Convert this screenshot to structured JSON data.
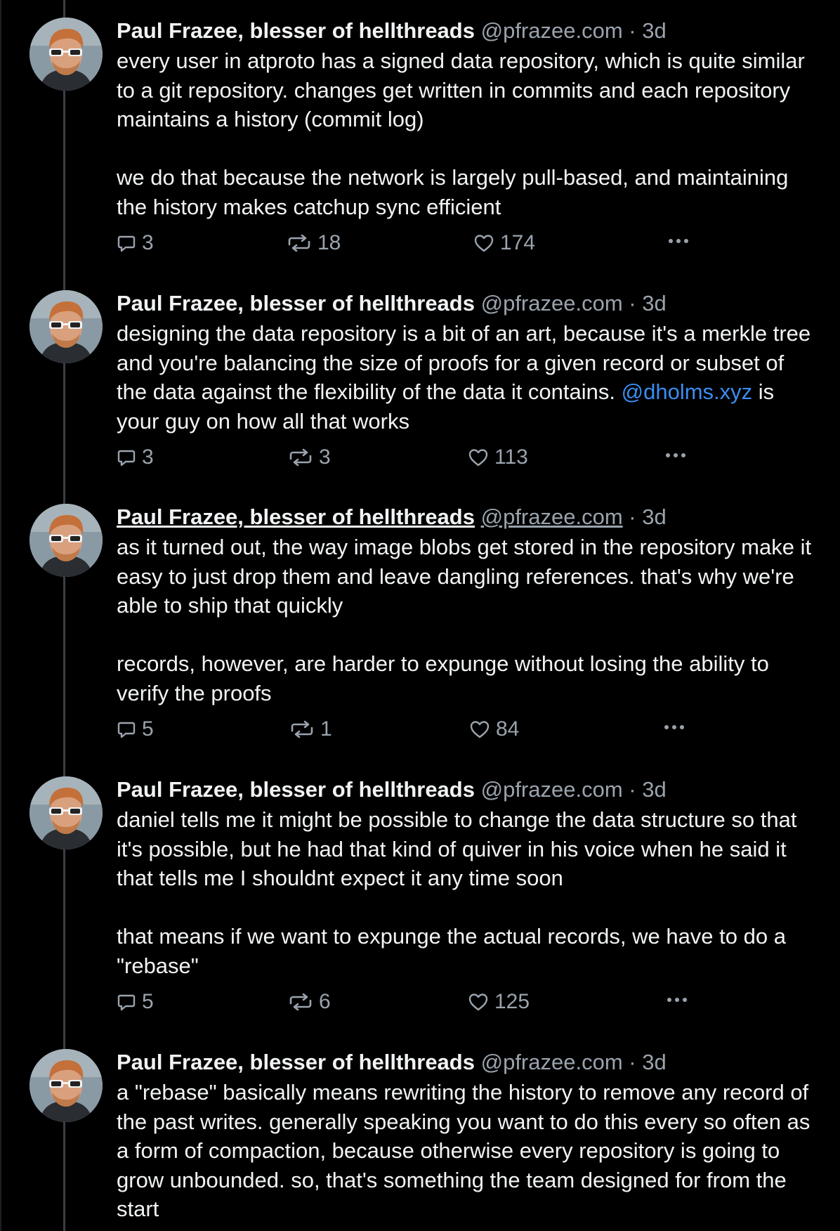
{
  "posts": [
    {
      "author": "Paul Frazee, blesser of hellthreads",
      "handle": "@pfrazee.com",
      "separator": "·",
      "time": "3d",
      "paragraphs": [
        "every user in atproto has a signed data repository, which is quite similar to a git repository. changes get written in commits and each repository maintains a history (commit log)",
        "we do that because the network is largely pull-based, and maintaining the history makes catchup sync efficient"
      ],
      "replies": "3",
      "reposts": "18",
      "likes": "174"
    },
    {
      "author": "Paul Frazee, blesser of hellthreads",
      "handle": "@pfrazee.com",
      "separator": "·",
      "time": "3d",
      "text_before": "designing the data repository is a bit of an art, because it's a merkle tree and you're balancing the size of proofs for a given record or subset of the data against the flexibility of the data it contains. ",
      "mention": "@dholms.xyz",
      "text_after": " is your guy on how all that works",
      "replies": "3",
      "reposts": "3",
      "likes": "113"
    },
    {
      "author": "Paul Frazee, blesser of hellthreads",
      "handle": "@pfrazee.com",
      "separator": "·",
      "time": "3d",
      "paragraphs": [
        "as it turned out, the way image blobs get stored in the repository make it easy to just drop them and leave dangling references. that's why we're able to ship that quickly",
        "records, however, are harder to expunge without losing the ability to verify the proofs"
      ],
      "replies": "5",
      "reposts": "1",
      "likes": "84"
    },
    {
      "author": "Paul Frazee, blesser of hellthreads",
      "handle": "@pfrazee.com",
      "separator": "·",
      "time": "3d",
      "paragraphs": [
        "daniel tells me it might be possible to change the data structure so that it's possible, but he had that kind of quiver in his voice when he said it that tells me I shouldnt expect it any time soon",
        "that means if we want to expunge the actual records, we have to do a \"rebase\""
      ],
      "replies": "5",
      "reposts": "6",
      "likes": "125"
    },
    {
      "author": "Paul Frazee, blesser of hellthreads",
      "handle": "@pfrazee.com",
      "separator": "·",
      "time": "3d",
      "paragraphs": [
        "a \"rebase\" basically means rewriting the history to remove any record of the past writes. generally speaking you want to do this every so often as a form of compaction, because otherwise every repository is going to grow unbounded. so, that's something the team designed for from the start"
      ]
    }
  ],
  "icons": {
    "reply": "speech-bubble-icon",
    "repost": "repost-arrows-icon",
    "like": "heart-icon",
    "more": "ellipsis-icon"
  },
  "colors": {
    "background": "#000000",
    "text": "#f1f3f5",
    "muted": "#9aa3ad",
    "mention": "#3b8cf0",
    "thread_line": "#3a3f47"
  }
}
